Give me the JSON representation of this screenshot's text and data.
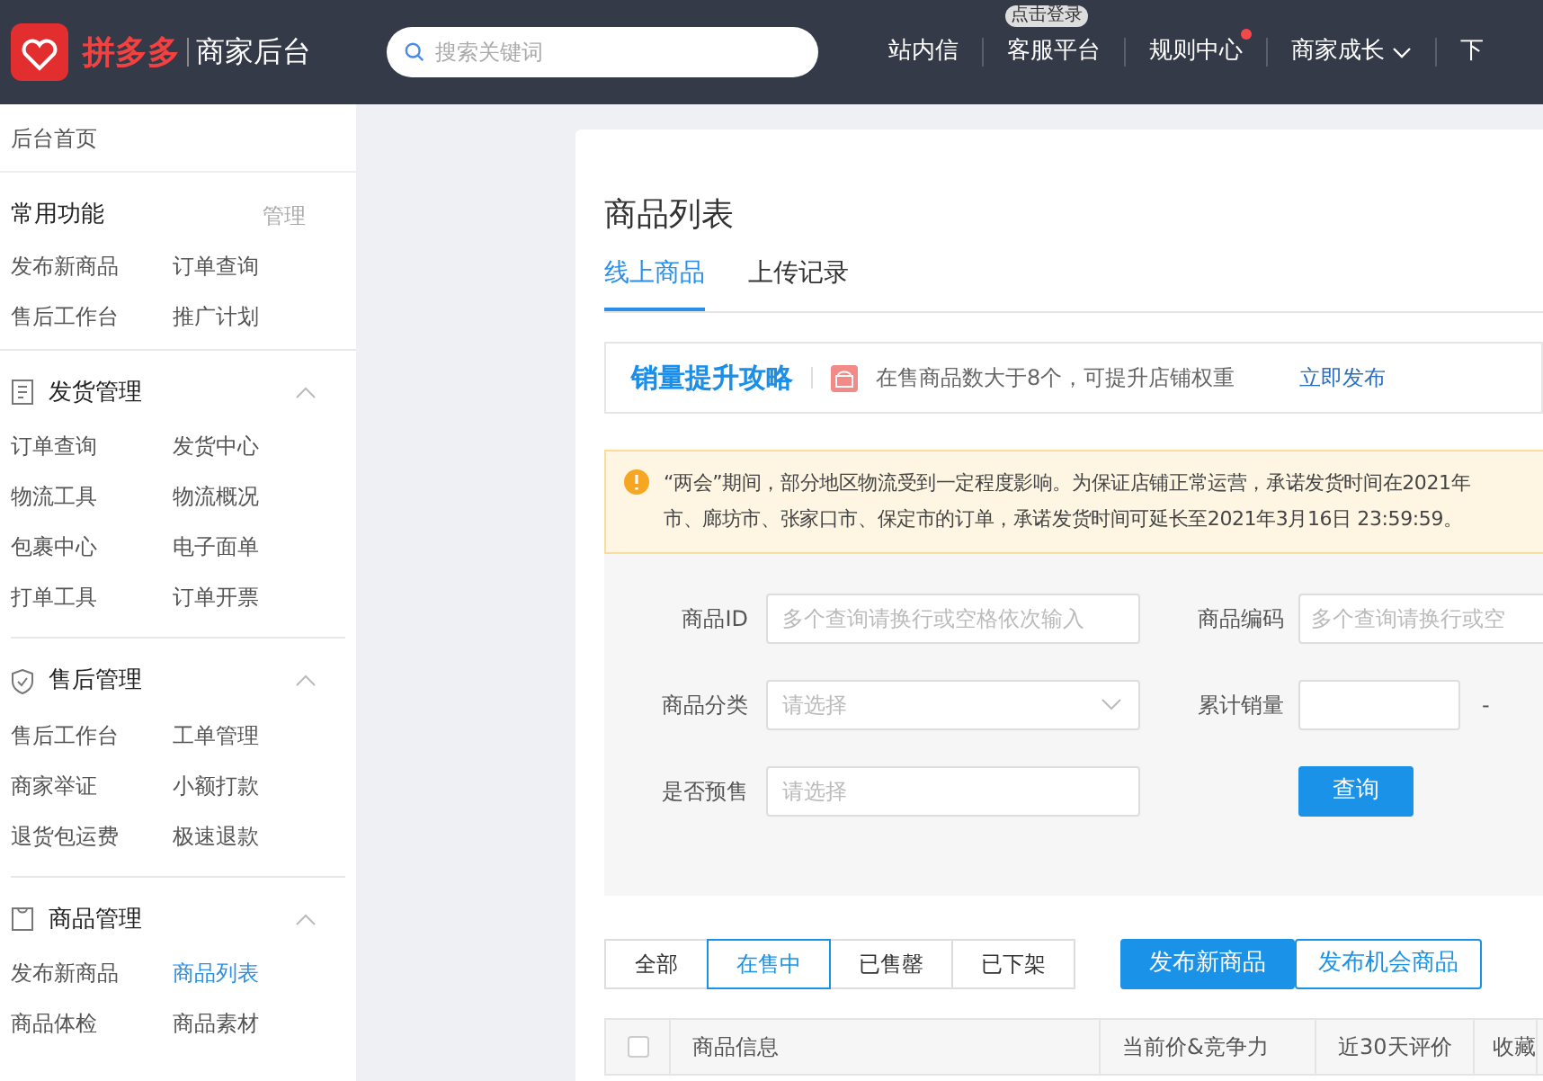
{
  "header": {
    "logo_text": "拼多多",
    "subtitle": "商家后台",
    "search": {
      "placeholder": "搜索关键词"
    },
    "nav": [
      {
        "label": "站内信"
      },
      {
        "label": "客服平台",
        "badge": "点击登录"
      },
      {
        "label": "规则中心",
        "dot": true
      },
      {
        "label": "商家成长",
        "dropdown": true
      },
      {
        "label": "下"
      }
    ]
  },
  "sidebar": {
    "home": "后台首页",
    "common": {
      "title": "常用功能",
      "action": "管理",
      "items": [
        {
          "label": "发布新商品",
          "selected": false
        },
        {
          "label": "订单查询",
          "selected": false
        },
        {
          "label": "售后工作台",
          "selected": false
        },
        {
          "label": "推广计划",
          "selected": false
        }
      ]
    },
    "sections": [
      {
        "title": "发货管理",
        "expanded": true,
        "items": [
          {
            "label": "订单查询",
            "selected": false
          },
          {
            "label": "发货中心",
            "selected": false
          },
          {
            "label": "物流工具",
            "selected": false
          },
          {
            "label": "物流概况",
            "selected": false
          },
          {
            "label": "包裹中心",
            "selected": false
          },
          {
            "label": "电子面单",
            "selected": false
          },
          {
            "label": "打单工具",
            "selected": false
          },
          {
            "label": "订单开票",
            "selected": false
          }
        ]
      },
      {
        "title": "售后管理",
        "expanded": true,
        "items": [
          {
            "label": "售后工作台",
            "selected": false
          },
          {
            "label": "工单管理",
            "selected": false
          },
          {
            "label": "商家举证",
            "selected": false
          },
          {
            "label": "小额打款",
            "selected": false
          },
          {
            "label": "退货包运费",
            "selected": false
          },
          {
            "label": "极速退款",
            "selected": false
          }
        ]
      },
      {
        "title": "商品管理",
        "expanded": true,
        "items": [
          {
            "label": "发布新商品",
            "selected": false
          },
          {
            "label": "商品列表",
            "selected": true
          },
          {
            "label": "商品体检",
            "selected": false
          },
          {
            "label": "商品素材",
            "selected": false
          }
        ]
      }
    ]
  },
  "page": {
    "title": "商品列表",
    "tabs": [
      {
        "label": "线上商品",
        "selected": true
      },
      {
        "label": "上传记录",
        "selected": false
      }
    ],
    "promo": {
      "title": "销量提升攻略",
      "text": "在售商品数大于8个，可提升店铺权重",
      "link": "立即发布"
    },
    "notice": {
      "lines": [
        "“两会”期间，部分地区物流受到一定程度影响。为保证店铺正常运营，承诺发货时间在2021年",
        "市、廊坊市、张家口市、保定市的订单，承诺发货时间可延长至2021年3月16日 23:59:59。"
      ]
    },
    "filters": {
      "left": [
        {
          "label": "商品ID",
          "kind": "text",
          "placeholder": "多个查询请换行或空格依次输入"
        },
        {
          "label": "商品分类",
          "kind": "select",
          "placeholder": "请选择"
        },
        {
          "label": "是否预售",
          "kind": "select-plain",
          "placeholder": "请选择"
        }
      ],
      "right": [
        {
          "label": "商品编码",
          "kind": "text",
          "placeholder": "多个查询请换行或空"
        },
        {
          "label": "累计销量",
          "kind": "range",
          "separator": "-"
        }
      ],
      "query_button": "查询"
    },
    "status_tabs": [
      {
        "label": "全部",
        "selected": false
      },
      {
        "label": "在售中",
        "selected": true
      },
      {
        "label": "已售罄",
        "selected": false
      },
      {
        "label": "已下架",
        "selected": false
      }
    ],
    "buttons": [
      {
        "label": "发布新商品",
        "kind": "primary"
      },
      {
        "label": "发布机会商品",
        "kind": "outline"
      }
    ],
    "table": {
      "select_all_checked": false,
      "columns": [
        "商品信息",
        "当前价&竞争力",
        "近30天评价",
        "收藏"
      ]
    }
  }
}
